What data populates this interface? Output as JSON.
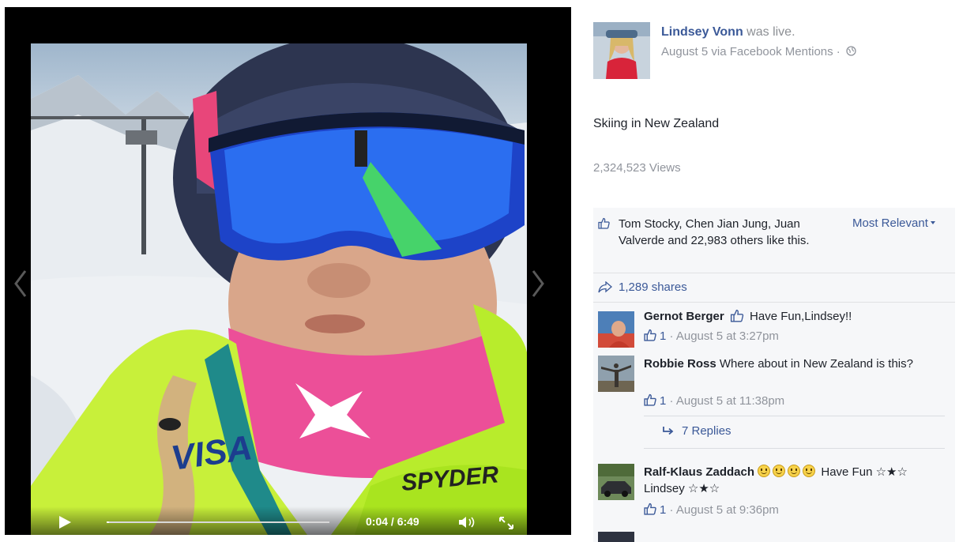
{
  "video": {
    "time_display": "0:04 / 6:49",
    "progress_fraction": 0.01
  },
  "post": {
    "author": "Lindsey Vonn",
    "action": " was live.",
    "meta": "August 5 via Facebook Mentions · ",
    "caption": "Skiing in New Zealand",
    "views": "2,324,523 Views"
  },
  "feedback": {
    "likes_text": "Tom Stocky, Chen Jian Jung, Juan Valverde and 22,983 others like this.",
    "sort_label": "Most Relevant",
    "shares_label": "1,289 shares"
  },
  "comments": [
    {
      "name": "Gernot Berger",
      "text": "Have Fun,Lindsey!!",
      "likes": "1",
      "meta": " · August 5 at 3:27pm"
    },
    {
      "name": "Robbie Ross",
      "text": "Where about in New Zealand is this?",
      "likes": "1",
      "meta": " · August 5 at 11:38pm",
      "replies": "7 Replies"
    },
    {
      "name": "Ralf-Klaus Zaddach",
      "text": "Have Fun ☆★☆ Lindsey ☆★☆",
      "likes": "1",
      "meta": " · August 5 at 9:36pm"
    }
  ],
  "colors": {
    "link": "#3b5998",
    "meta": "#90949c",
    "panel": "#f6f7f9"
  }
}
